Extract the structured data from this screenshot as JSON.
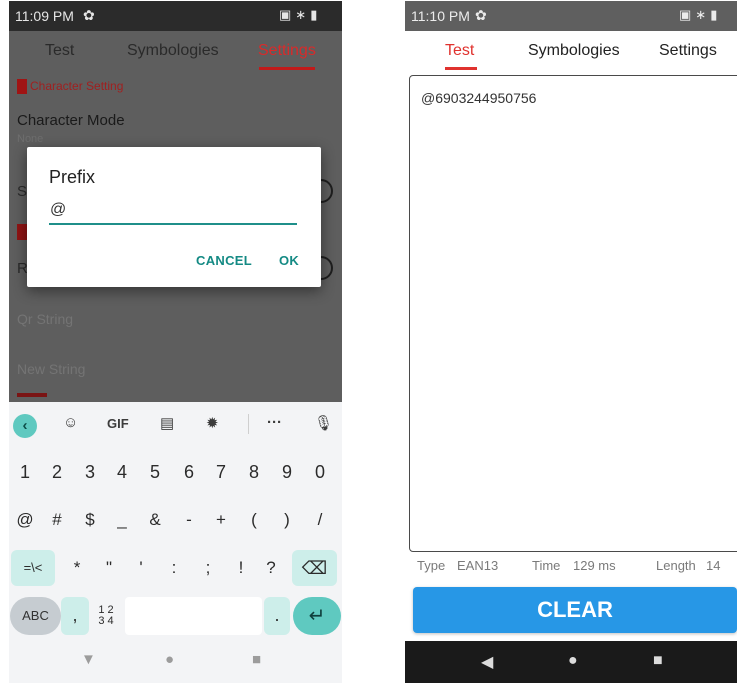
{
  "left_screen": {
    "status_bar": {
      "time": "11:09 PM"
    },
    "tabs": [
      {
        "label": "Test"
      },
      {
        "label": "Symbologies"
      },
      {
        "label": "Settings"
      }
    ],
    "section_header": "Character Setting",
    "character_mode": {
      "title": "Character Mode",
      "value": "None"
    },
    "dimmed_items": [
      "Qr String",
      "New String"
    ],
    "dialog": {
      "title": "Prefix",
      "input_value": "@",
      "cancel_label": "CANCEL",
      "ok_label": "OK"
    },
    "keyboard": {
      "toolbar": [
        "GIF"
      ],
      "number_row": [
        "1",
        "2",
        "3",
        "4",
        "5",
        "6",
        "7",
        "8",
        "9",
        "0"
      ],
      "symbol_row": [
        "@",
        "#",
        "$",
        "_",
        "&",
        "-",
        "+",
        "(",
        ")",
        "/"
      ],
      "third_row": [
        "=\\<",
        "*",
        "\"",
        "'",
        ":",
        ";",
        "!",
        "?"
      ],
      "bottom_row": {
        "abc": "ABC",
        "comma": ",",
        "numpad_top": "1 2",
        "numpad_bottom": "3 4",
        "period": "."
      }
    }
  },
  "right_screen": {
    "status_bar": {
      "time": "11:10 PM"
    },
    "tabs": [
      {
        "label": "Test"
      },
      {
        "label": "Symbologies"
      },
      {
        "label": "Settings"
      }
    ],
    "scan_result": "@6903244950756",
    "info": {
      "type_label": "Type",
      "type_value": "EAN13",
      "time_label": "Time",
      "time_value": "129 ms",
      "length_label": "Length",
      "length_value": "14"
    },
    "clear_button": "CLEAR"
  }
}
